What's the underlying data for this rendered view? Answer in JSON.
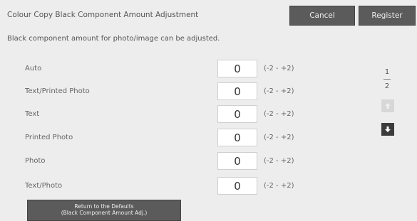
{
  "header": {
    "title": "Colour Copy Black Component Amount Adjustment",
    "cancel_label": "Cancel",
    "register_label": "Register"
  },
  "description": "Black component amount for photo/image can be adjusted.",
  "rows": [
    {
      "label": "Auto",
      "value": "0",
      "range": "(-2 - +2)"
    },
    {
      "label": "Text/Printed Photo",
      "value": "0",
      "range": "(-2 - +2)"
    },
    {
      "label": "Text",
      "value": "0",
      "range": "(-2 - +2)"
    },
    {
      "label": "Printed Photo",
      "value": "0",
      "range": "(-2 - +2)"
    },
    {
      "label": "Photo",
      "value": "0",
      "range": "(-2 - +2)"
    },
    {
      "label": "Text/Photo",
      "value": "0",
      "range": "(-2 - +2)"
    }
  ],
  "pager": {
    "current": "1",
    "total": "2"
  },
  "icons": {
    "up": "arrow-up-icon",
    "down": "arrow-down-icon"
  },
  "reset": {
    "line1": "Return to the Defaults",
    "line2": "(Black Component Amount Adj.)"
  }
}
